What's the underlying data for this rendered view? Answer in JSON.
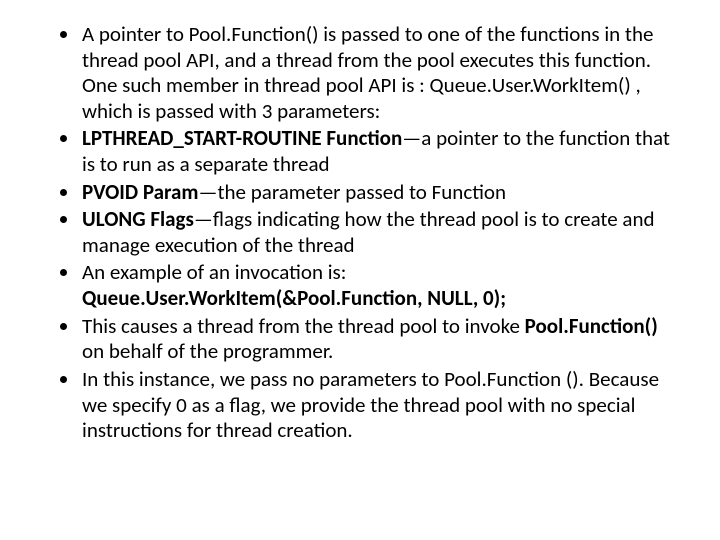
{
  "bullets": {
    "b1": {
      "text": "A pointer to Pool.Function() is passed to one of the functions in the thread pool API, and a thread from the pool executes this function. One such member in thread pool API is  : Queue.User.WorkItem() , which is passed with 3  parameters:"
    },
    "b2": {
      "lead": " ",
      "bold": "LPTHREAD_START-ROUTINE Function",
      "rest": "—a pointer to the function that is to run as a separate thread"
    },
    "b3": {
      "bold": "PVOID Param",
      "rest": "—the parameter passed to Function"
    },
    "b4": {
      "lead": " ",
      "bold": "ULONG Flags",
      "rest": "—flags indicating how the thread pool is to create and manage execution of the thread"
    },
    "b5": {
      "line1": "An example of an invocation is:",
      "line2": "Queue.User.WorkItem(&Pool.Function, NULL, 0);"
    },
    "b6": {
      "pre": "This causes a thread from the thread pool to invoke ",
      "bold": "Pool.Function()",
      "post": " on behalf of the programmer."
    },
    "b7": {
      "text": "In this instance, we pass no parameters to Pool.Function (). Because we specify 0 as a flag, we provide the thread pool with no special instructions for thread creation."
    }
  }
}
